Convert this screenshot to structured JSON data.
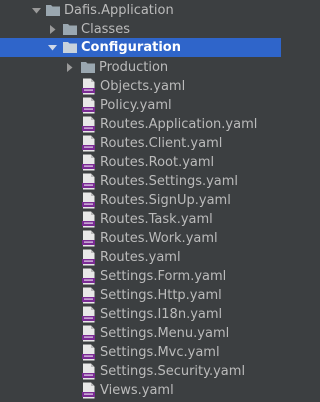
{
  "tree": {
    "root": {
      "label": "Dafis.Application",
      "expanded": true,
      "icon": "folder-icon"
    },
    "classes": {
      "label": "Classes",
      "expanded": false,
      "icon": "folder-icon"
    },
    "configuration": {
      "label": "Configuration",
      "expanded": true,
      "selected": true,
      "icon": "folder-icon"
    },
    "production": {
      "label": "Production",
      "expanded": false,
      "icon": "folder-icon"
    },
    "files": [
      {
        "label": "Objects.yaml",
        "icon": "yaml-file-icon"
      },
      {
        "label": "Policy.yaml",
        "icon": "yaml-file-icon"
      },
      {
        "label": "Routes.Application.yaml",
        "icon": "yaml-file-icon"
      },
      {
        "label": "Routes.Client.yaml",
        "icon": "yaml-file-icon"
      },
      {
        "label": "Routes.Root.yaml",
        "icon": "yaml-file-icon"
      },
      {
        "label": "Routes.Settings.yaml",
        "icon": "yaml-file-icon"
      },
      {
        "label": "Routes.SignUp.yaml",
        "icon": "yaml-file-icon"
      },
      {
        "label": "Routes.Task.yaml",
        "icon": "yaml-file-icon"
      },
      {
        "label": "Routes.Work.yaml",
        "icon": "yaml-file-icon"
      },
      {
        "label": "Routes.yaml",
        "icon": "yaml-file-icon"
      },
      {
        "label": "Settings.Form.yaml",
        "icon": "yaml-file-icon"
      },
      {
        "label": "Settings.Http.yaml",
        "icon": "yaml-file-icon"
      },
      {
        "label": "Settings.I18n.yaml",
        "icon": "yaml-file-icon"
      },
      {
        "label": "Settings.Menu.yaml",
        "icon": "yaml-file-icon"
      },
      {
        "label": "Settings.Mvc.yaml",
        "icon": "yaml-file-icon"
      },
      {
        "label": "Settings.Security.yaml",
        "icon": "yaml-file-icon"
      },
      {
        "label": "Views.yaml",
        "icon": "yaml-file-icon"
      }
    ]
  },
  "colors": {
    "background": "#3c3f41",
    "selection": "#2f65ca",
    "text": "#bbbbbb",
    "folder": "#9aa7b0",
    "yaml_badge": "#7a2b94"
  }
}
